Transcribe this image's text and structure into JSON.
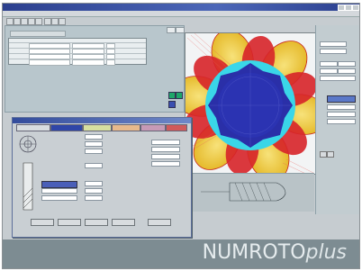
{
  "app": {
    "brand_main": "NUMROTO",
    "brand_suffix": "plus"
  },
  "colors": {
    "window_bg": "#c6ccd0",
    "titlebar": "#2b3f8e",
    "viewport_disc": "#2a2fa8",
    "lobe_yellow": "#f4d34a",
    "lobe_red": "#d8242a",
    "ring_cyan": "#3ad6e8"
  },
  "icons": [
    "minimize-icon",
    "maximize-icon",
    "close-icon",
    "rosette-icon",
    "cutter-profile-icon"
  ]
}
